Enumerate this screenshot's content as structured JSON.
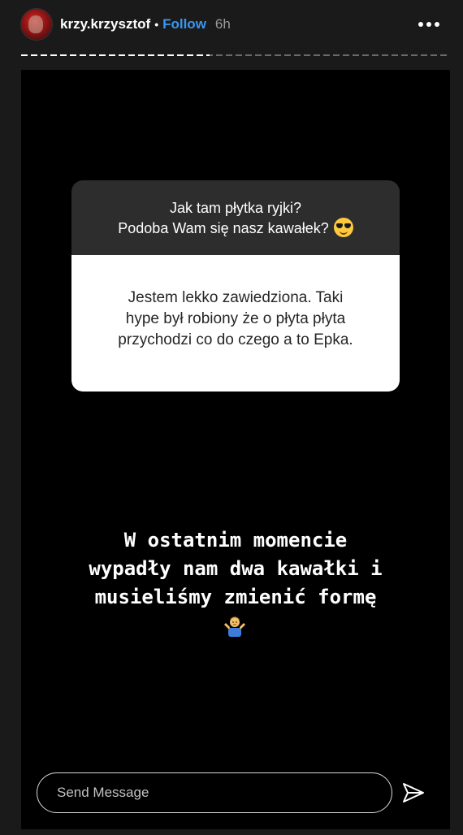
{
  "header": {
    "username": "krzy.krzysztof",
    "separator": "•",
    "follow_label": "Follow",
    "time": "6h",
    "more_icon": "more-horizontal-icon"
  },
  "progress": {
    "segment_count": 1,
    "fraction_viewed": 0.44
  },
  "question_box": {
    "question_line1": "Jak tam płytka ryjki?",
    "question_line2": "Podoba Wam się nasz kawałek?",
    "question_emoji": "smiling-face-with-sunglasses-icon",
    "answer_line1": "Jestem lekko zawiedziona. Taki",
    "answer_line2": "hype był robiony że o płyta płyta",
    "answer_line3": "przychodzi co do czego a to Epka."
  },
  "caption": {
    "line1": "W ostatnim momencie",
    "line2": "wypadły nam dwa kawałki i",
    "line3": "musieliśmy zmienić formę",
    "emoji": "man-shrugging-icon"
  },
  "message_bar": {
    "placeholder": "Send Message",
    "send_icon": "send-paper-plane-icon"
  },
  "colors": {
    "background": "#1a1a1a",
    "story_background": "#000000",
    "follow": "#3897f0",
    "question_box_top": "#2d2d2d",
    "answer_box": "#ffffff"
  }
}
